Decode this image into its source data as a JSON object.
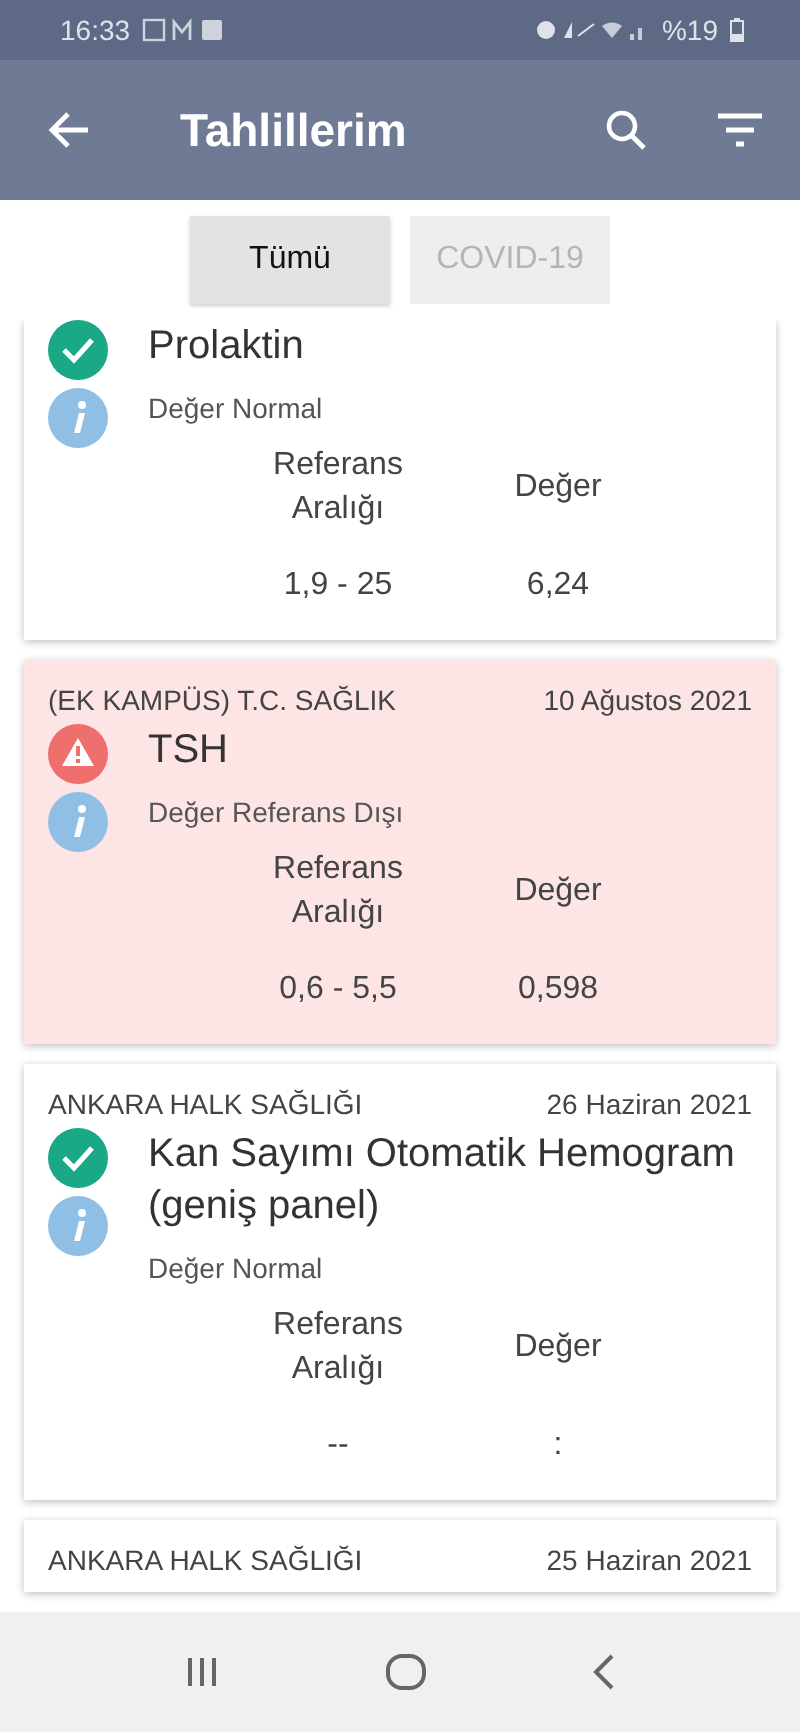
{
  "status_bar": {
    "time": "16:33",
    "battery": "%19"
  },
  "app_bar": {
    "title": "Tahlillerim"
  },
  "tabs": [
    {
      "label": "Tümü",
      "selected": true
    },
    {
      "label": "COVID-19",
      "selected": false
    }
  ],
  "results": [
    {
      "abnormal": false,
      "test": "Prolaktin",
      "status_text": "Değer Normal",
      "range_label": "Referans Aralığı",
      "value_label": "Değer",
      "range": "1,9 - 25",
      "value": "6,24"
    },
    {
      "institution": "(EK KAMPÜS) T.C. SAĞLIK",
      "date": "10 Ağustos 2021",
      "abnormal": true,
      "test": "TSH",
      "status_text": "Değer Referans Dışı",
      "range_label": "Referans Aralığı",
      "value_label": "Değer",
      "range": "0,6 - 5,5",
      "value": "0,598"
    },
    {
      "institution": "ANKARA HALK SAĞLIĞI",
      "date": "26 Haziran 2021",
      "abnormal": false,
      "test": "Kan Sayımı Otomatik Hemogram (geniş panel)",
      "status_text": "Değer Normal",
      "range_label": "Referans Aralığı",
      "value_label": "Değer",
      "range": "--",
      "value": ":"
    },
    {
      "institution": "ANKARA HALK SAĞLIĞI",
      "date": "25 Haziran 2021"
    }
  ]
}
